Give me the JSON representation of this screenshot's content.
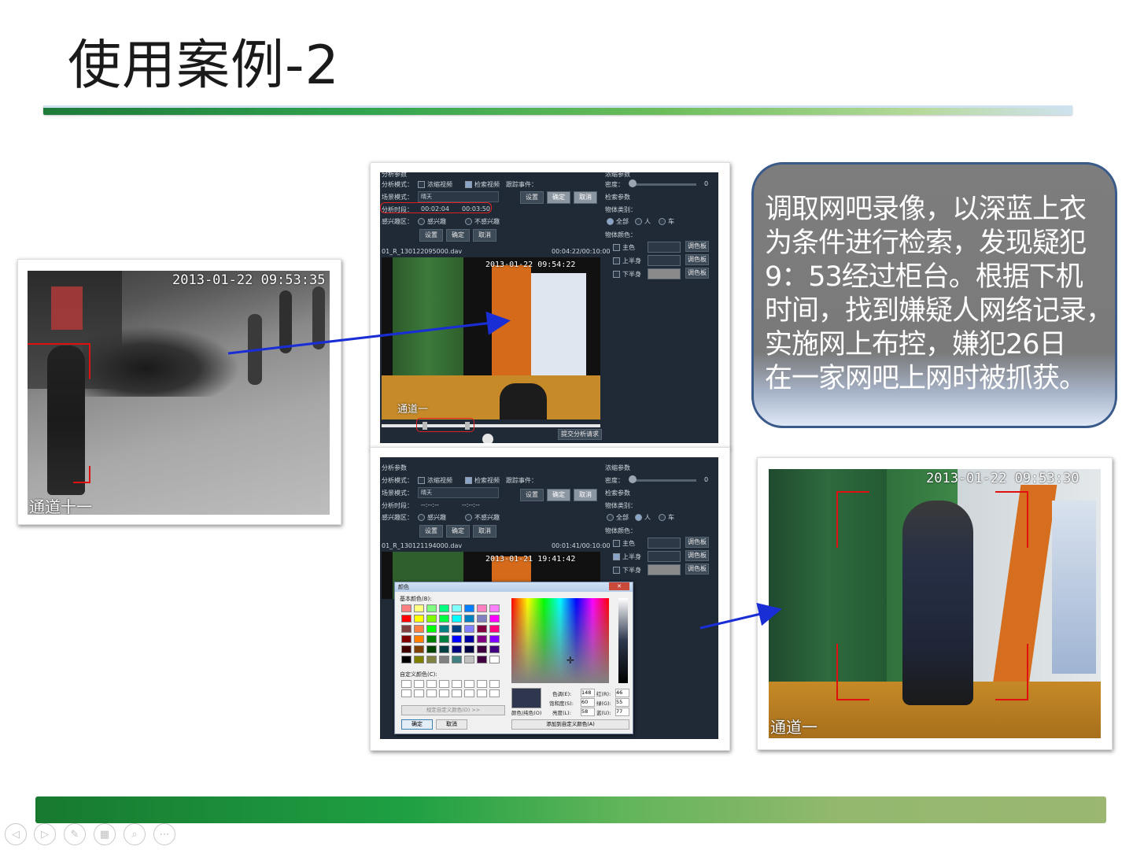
{
  "slide": {
    "title": "使用案例-2"
  },
  "left_photo": {
    "timestamp": "2013-01-22  09:53:35",
    "channel": "通道十一"
  },
  "panel_top": {
    "labels": {
      "params": "分析参数",
      "mode": "分析模式：",
      "condense": "浓缩视频",
      "search": "检索视频",
      "track": "跟踪事件：",
      "scene": "场景模式：",
      "scene_value": "晴天",
      "time": "分析时段：",
      "time_start": "00:02:04",
      "time_end": "00:03:50",
      "roi": "感兴趣区：",
      "roi_yes": "感兴趣",
      "roi_no": "不感兴趣",
      "set": "设置",
      "ok": "确定",
      "cancel": "取消",
      "filename": "01_R_130122095000.dav",
      "duration": "00:04:22/00:10:00",
      "cond_params": "浓缩参数",
      "density": "密度：",
      "density_val": "0",
      "search_params": "检索参数",
      "obj_type": "物体类别：",
      "all": "全部",
      "person": "人",
      "car": "车",
      "obj_color": "物体颜色：",
      "main": "主色",
      "upper": "上半身",
      "lower": "下半身",
      "palette": "调色板",
      "submit": "提交分析请求"
    },
    "video_timestamp": "2013-01-22  09:54:22",
    "video_channel": "通道一"
  },
  "panel_bottom": {
    "labels": {
      "params": "分析参数",
      "mode": "分析模式：",
      "condense": "浓缩视频",
      "search": "检索视频",
      "track": "跟踪事件：",
      "scene": "场景模式：",
      "scene_value": "晴天",
      "time": "分析时段：",
      "time_start": "--:--:--",
      "time_end": "--:--:--",
      "roi": "感兴趣区：",
      "roi_yes": "感兴趣",
      "roi_no": "不感兴趣",
      "set": "设置",
      "ok": "确定",
      "cancel": "取消",
      "filename": "01_R_130121194000.dav",
      "duration": "00:01:41/00:10:00",
      "cond_params": "浓缩参数",
      "density": "密度：",
      "density_val": "0",
      "search_params": "检索参数",
      "obj_type": "物体类别：",
      "all": "全部",
      "person": "人",
      "car": "车",
      "obj_color": "物体颜色：",
      "main": "主色",
      "upper": "上半身",
      "lower": "下半身",
      "palette": "调色板"
    },
    "video_timestamp": "2013-01-21  19:41:42"
  },
  "color_dialog": {
    "title": "颜色",
    "close": "✕",
    "basic_colors": "基本颜色(B):",
    "custom_colors": "自定义颜色(C):",
    "define_custom": "规定自定义颜色(D) >>",
    "ok": "确定",
    "cancel": "取消",
    "color_solid": "颜色|纯色(O)",
    "hue_label": "色调(E):",
    "hue_val": "148",
    "sat_label": "饱和度(S):",
    "sat_val": "60",
    "lum_label": "亮度(L):",
    "lum_val": "58",
    "red_label": "红(R):",
    "red_val": "46",
    "green_label": "绿(G):",
    "green_val": "55",
    "blue_label": "蓝(U):",
    "blue_val": "77",
    "add_custom": "添加到自定义颜色(A)",
    "swatches": [
      "#ff8080",
      "#ffff80",
      "#80ff80",
      "#00ff80",
      "#80ffff",
      "#0080ff",
      "#ff80c0",
      "#ff80ff",
      "#ff0000",
      "#ffff00",
      "#80ff00",
      "#00ff40",
      "#00ffff",
      "#0080c0",
      "#8080c0",
      "#ff00ff",
      "#804040",
      "#ff8040",
      "#00ff00",
      "#008080",
      "#004080",
      "#8080ff",
      "#800040",
      "#ff0080",
      "#800000",
      "#ff8000",
      "#008000",
      "#008040",
      "#0000ff",
      "#0000a0",
      "#800080",
      "#8000ff",
      "#400000",
      "#804000",
      "#004000",
      "#004040",
      "#000080",
      "#000040",
      "#400040",
      "#400080",
      "#000000",
      "#808000",
      "#808040",
      "#808080",
      "#408080",
      "#c0c0c0",
      "#400040",
      "#ffffff"
    ],
    "selected_color": "#2e374d"
  },
  "right_photo": {
    "timestamp": "2013-01-22  09:53:30",
    "channel": "通道一"
  },
  "callout": {
    "lines": [
      "调取网吧录像，以深蓝上衣",
      "为条件进行检索，发现疑犯",
      "9：53经过柜台。根据下机",
      "时间，找到嫌疑人网络记录，",
      "实施网上布控，嫌犯26日",
      "在一家网吧上网时被抓获。"
    ]
  },
  "nav": {
    "prev": "◁",
    "next": "▷",
    "pen": "✎",
    "slides": "▦",
    "zoom": "⌕",
    "more": "⋯"
  }
}
